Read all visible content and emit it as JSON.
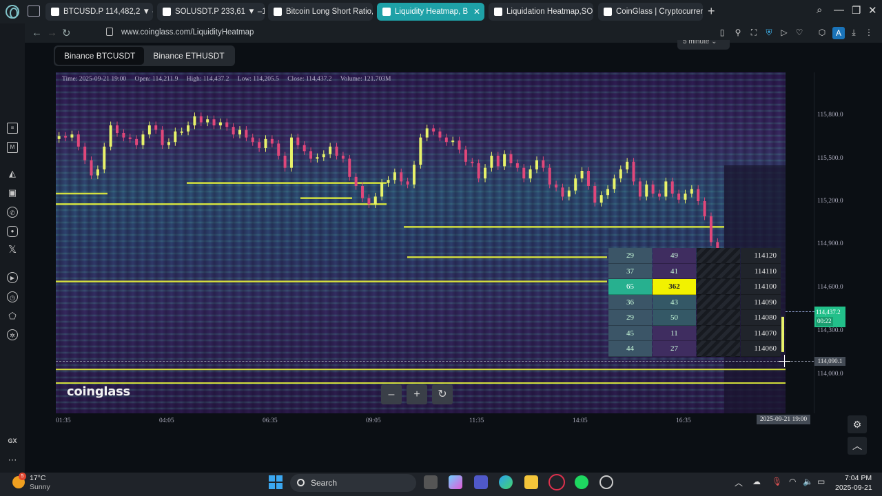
{
  "browser": {
    "tabs": [
      {
        "label": "BTCUSD.P 114,482,2 ▼ –",
        "active": false
      },
      {
        "label": "SOLUSDT.P 233,61 ▼ –1",
        "active": false
      },
      {
        "label": "Bitcoin Long Short Ratio,",
        "active": false
      },
      {
        "label": "Liquidity Heatmap, B",
        "active": true
      },
      {
        "label": "Liquidation Heatmap,SOL",
        "active": false
      },
      {
        "label": "CoinGlass | Cryptocurrenc",
        "active": false
      }
    ],
    "url": "www.coinglass.com/LiquidityHeatmap",
    "profile_initial": "A"
  },
  "pair_tabs": [
    {
      "label": "Binance BTCUSDT",
      "active": true
    },
    {
      "label": "Binance ETHUSDT",
      "active": false
    }
  ],
  "interval_label": "5 minute",
  "ohlc": {
    "time": "Time: 2025-09-21 19:00",
    "open": "Open: 114,211.9",
    "high": "High: 114,437.2",
    "low": "Low: 114,205.5",
    "close": "Close: 114,437.2",
    "volume": "Volume: 121.703M"
  },
  "y_axis_labels": [
    "115,800.0",
    "115,500.0",
    "115,200.0",
    "114,900.0",
    "114,600.0",
    "114,300.0",
    "114,000.0"
  ],
  "x_axis_labels": [
    "01:35",
    "04:05",
    "06:35",
    "09:05",
    "11:35",
    "14:05",
    "16:35"
  ],
  "crosshair_time": "2025-09-21 19:00",
  "current_price": "114,437.2",
  "countdown": "00:22",
  "crosshair_price": "114,090.1",
  "order_book": [
    {
      "left": "29",
      "mid": "49",
      "price": "114120"
    },
    {
      "left": "37",
      "mid": "41",
      "price": "114110"
    },
    {
      "left": "65",
      "mid": "362",
      "price": "114100",
      "highlight": true
    },
    {
      "left": "36",
      "mid": "43",
      "price": "114090"
    },
    {
      "left": "29",
      "mid": "50",
      "price": "114080"
    },
    {
      "left": "45",
      "mid": "11",
      "price": "114070"
    },
    {
      "left": "44",
      "mid": "27",
      "price": "114060"
    }
  ],
  "logo_text": "coinglass",
  "zoom_controls": [
    "–",
    "+",
    "↻"
  ],
  "colors": {
    "accent_tab": "#1ea1a7",
    "up_candle": "#e8f26a",
    "down_candle": "#e0477a",
    "liquidity_line": "#e6f23a",
    "highlight_cell": "#f2f200"
  },
  "chart_data": {
    "type": "heatmap",
    "ylim": [
      113800,
      116050
    ],
    "y_ticks": [
      115800,
      115500,
      115200,
      114900,
      114600,
      114300,
      114000
    ],
    "x_ticks": [
      "01:35",
      "04:05",
      "06:35",
      "09:05",
      "11:35",
      "14:05",
      "16:35"
    ],
    "candles_close": [
      115630,
      115620,
      115640,
      115560,
      115470,
      115370,
      115410,
      115560,
      115700,
      115650,
      115620,
      115610,
      115570,
      115640,
      115700,
      115670,
      115570,
      115590,
      115660,
      115660,
      115700,
      115760,
      115720,
      115740,
      115700,
      115720,
      115690,
      115640,
      115670,
      115620,
      115590,
      115550,
      115610,
      115580,
      115500,
      115420,
      115620,
      115570,
      115530,
      115480,
      115490,
      115510,
      115560,
      115500,
      115480,
      115360,
      115300,
      115220,
      115180,
      115230,
      115320,
      115340,
      115390,
      115330,
      115310,
      115440,
      115620,
      115680,
      115660,
      115620,
      115590,
      115600,
      115540,
      115460,
      115450,
      115350,
      115420,
      115500,
      115430,
      115510,
      115450,
      115420,
      115350,
      115410,
      115470,
      115420,
      115310,
      115290,
      115230,
      115270,
      115350,
      115400,
      115300,
      115190,
      115240,
      115280,
      115350,
      115410,
      115460,
      115330,
      115230,
      115310,
      115250,
      115230,
      115330,
      115250,
      115210,
      115250,
      115280,
      115200,
      115100,
      114930,
      114850
    ],
    "liquidity_levels": [
      115180,
      115320,
      115220,
      115250,
      115030,
      114830,
      114670,
      114090,
      114000
    ]
  }
}
